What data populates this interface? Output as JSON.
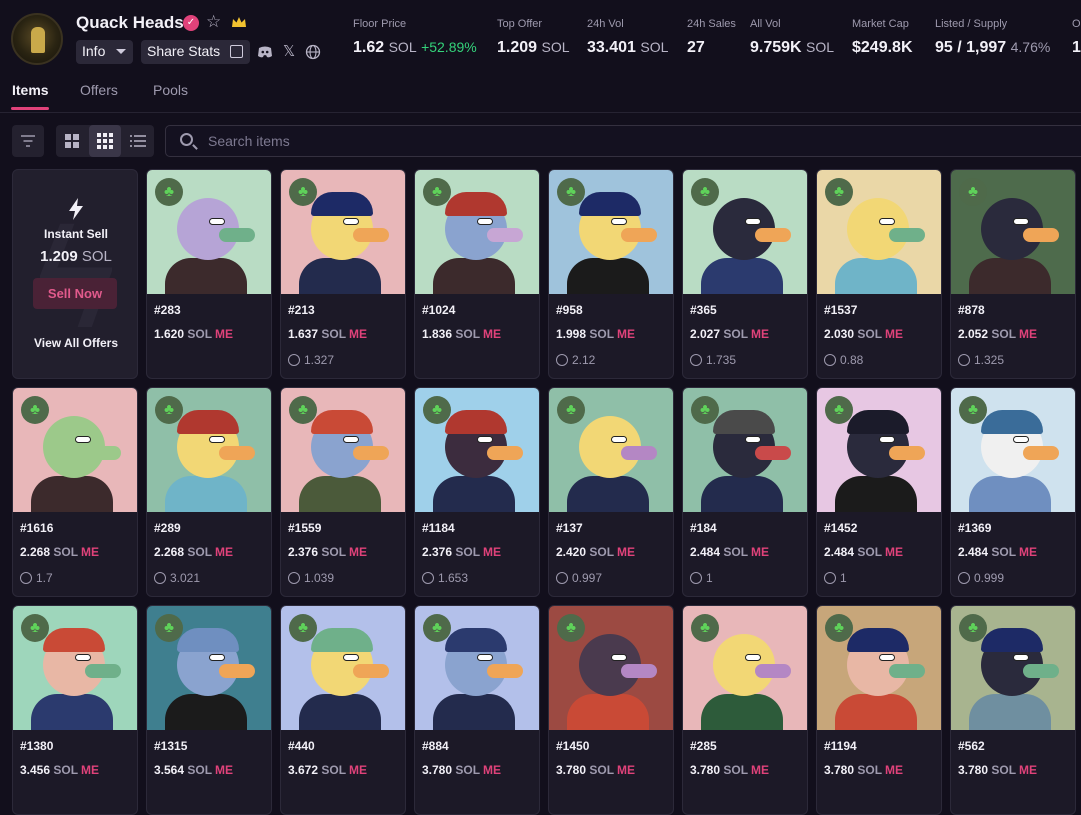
{
  "collection": {
    "name": "Quack Heads",
    "info_label": "Info",
    "share_label": "Share Stats"
  },
  "icons": {
    "verified": "verified-check-icon",
    "favorite": "star-icon",
    "royalty": "crown-icon",
    "discord": "discord-icon",
    "x": "x-icon",
    "website": "globe-icon"
  },
  "stats": [
    {
      "label": "Floor Price",
      "value": "1.62",
      "unit": "SOL",
      "change": "+52.89%"
    },
    {
      "label": "Top Offer",
      "value": "1.209",
      "unit": "SOL"
    },
    {
      "label": "24h Vol",
      "value": "33.401",
      "unit": "SOL"
    },
    {
      "label": "24h Sales",
      "value": "27"
    },
    {
      "label": "All Vol",
      "value": "9.759K",
      "unit": "SOL"
    },
    {
      "label": "Market Cap",
      "value": "$249.8K"
    },
    {
      "label": "Listed / Supply",
      "value": "95 / 1,997",
      "pct": "4.76%"
    },
    {
      "label": "O",
      "value": "1"
    }
  ],
  "tabs": [
    "Items",
    "Offers",
    "Pools"
  ],
  "search": {
    "placeholder": "Search items"
  },
  "instant_sell": {
    "label": "Instant Sell",
    "price": "1.209",
    "unit": "SOL",
    "button": "Sell Now",
    "view_all": "View All Offers"
  },
  "unit": "SOL",
  "marketplace_mark": "ME",
  "colors": {
    "accent": "#e0427a",
    "positive": "#34d27a",
    "background": "#120f1c",
    "card": "#1c1927"
  },
  "items": [
    {
      "id": "#283",
      "price": "1.620",
      "last": null,
      "bg": "#b9dcc4",
      "skin": "#b6a4d6",
      "bill": "#6fb08a",
      "hat": null,
      "jacket": "#3c2a2c"
    },
    {
      "id": "#213",
      "price": "1.637",
      "last": "1.327",
      "bg": "#e8b7b9",
      "skin": "#f2d775",
      "bill": "#efa557",
      "hat": "#1d2a66",
      "jacket": "#232b4d"
    },
    {
      "id": "#1024",
      "price": "1.836",
      "last": null,
      "bg": "#b9dcc4",
      "skin": "#8aa3cf",
      "bill": "#c7a6d4",
      "hat": "#b0382f",
      "jacket": "#3c2a2c"
    },
    {
      "id": "#958",
      "price": "1.998",
      "last": "2.12",
      "bg": "#9fc3dc",
      "skin": "#f2d775",
      "bill": "#efa557",
      "hat": "#1d2a66",
      "jacket": "#1b1b1b"
    },
    {
      "id": "#365",
      "price": "2.027",
      "last": "1.735",
      "bg": "#b9dcc4",
      "skin": "#2a2a3c",
      "bill": "#efa557",
      "hat": null,
      "jacket": "#2b3a6e"
    },
    {
      "id": "#1537",
      "price": "2.030",
      "last": "0.88",
      "bg": "#ead7a7",
      "skin": "#f2d775",
      "bill": "#6fb08a",
      "hat": null,
      "jacket": "#6fb4c8"
    },
    {
      "id": "#878",
      "price": "2.052",
      "last": "1.325",
      "bg": "#4e6b4c",
      "skin": "#2a2a3c",
      "bill": "#efa557",
      "hat": null,
      "jacket": "#3c2a2c"
    },
    {
      "id": "#1616",
      "price": "2.268",
      "last": "1.7",
      "bg": "#e8b7b9",
      "skin": "#9cc98a",
      "bill": "#9cc98a",
      "hat": null,
      "jacket": "#3c2a2c"
    },
    {
      "id": "#289",
      "price": "2.268",
      "last": "3.021",
      "bg": "#8fbfa8",
      "skin": "#f2d775",
      "bill": "#efa557",
      "hat": "#b0382f",
      "jacket": "#6fb4c8"
    },
    {
      "id": "#1559",
      "price": "2.376",
      "last": "1.039",
      "bg": "#e8b7b9",
      "skin": "#8aa3cf",
      "bill": "#efa557",
      "hat": "#c94a36",
      "jacket": "#4b5a3a"
    },
    {
      "id": "#1184",
      "price": "2.376",
      "last": "1.653",
      "bg": "#9fd0ea",
      "skin": "#3c2c3e",
      "bill": "#efa557",
      "hat": "#b0382f",
      "jacket": "#232b4d"
    },
    {
      "id": "#137",
      "price": "2.420",
      "last": "0.997",
      "bg": "#8fbfa8",
      "skin": "#f2d775",
      "bill": "#b487c4",
      "hat": null,
      "jacket": "#232b4d"
    },
    {
      "id": "#184",
      "price": "2.484",
      "last": "1",
      "bg": "#8fbfa8",
      "skin": "#2a2a3c",
      "bill": "#c94a4a",
      "hat": "#4a4a4a",
      "jacket": "#232b4d"
    },
    {
      "id": "#1452",
      "price": "2.484",
      "last": "1",
      "bg": "#e7c7e3",
      "skin": "#2a2a3c",
      "bill": "#efa557",
      "hat": "#1b1b2a",
      "jacket": "#1b1b1b"
    },
    {
      "id": "#1369",
      "price": "2.484",
      "last": "0.999",
      "bg": "#cfe2ee",
      "skin": "#f0f0f0",
      "bill": "#efa557",
      "hat": "#3a6c99",
      "jacket": "#6f8fc0"
    },
    {
      "id": "#1380",
      "price": "3.456",
      "last": null,
      "bg": "#9ed6bb",
      "skin": "#e8b7a5",
      "bill": "#6fb08a",
      "hat": "#c94a36",
      "jacket": "#2b3a6e"
    },
    {
      "id": "#1315",
      "price": "3.564",
      "last": null,
      "bg": "#3f7f8f",
      "skin": "#8aa3cf",
      "bill": "#efa557",
      "hat": "#6f8fc0",
      "jacket": "#1b1b1b"
    },
    {
      "id": "#440",
      "price": "3.672",
      "last": null,
      "bg": "#b3c0ea",
      "skin": "#f2d775",
      "bill": "#efa557",
      "hat": "#6fb08a",
      "jacket": "#232b4d"
    },
    {
      "id": "#884",
      "price": "3.780",
      "last": null,
      "bg": "#b3c0ea",
      "skin": "#8aa3cf",
      "bill": "#efa557",
      "hat": "#2b3a6e",
      "jacket": "#232b4d"
    },
    {
      "id": "#1450",
      "price": "3.780",
      "last": null,
      "bg": "#9c4a42",
      "skin": "#4a3a4e",
      "bill": "#b487c4",
      "hat": null,
      "jacket": "#c94a36"
    },
    {
      "id": "#285",
      "price": "3.780",
      "last": null,
      "bg": "#e8b7b9",
      "skin": "#f2d775",
      "bill": "#b487c4",
      "hat": null,
      "jacket": "#2d5b3a"
    },
    {
      "id": "#1194",
      "price": "3.780",
      "last": null,
      "bg": "#c7a67a",
      "skin": "#e8b7a5",
      "bill": "#6fb08a",
      "hat": "#1d2a66",
      "jacket": "#c94a36"
    },
    {
      "id": "#562",
      "price": "3.780",
      "last": null,
      "bg": "#a8b48f",
      "skin": "#2a2a3c",
      "bill": "#6fb08a",
      "hat": "#1d2a66",
      "jacket": "#6f8fa0"
    }
  ]
}
